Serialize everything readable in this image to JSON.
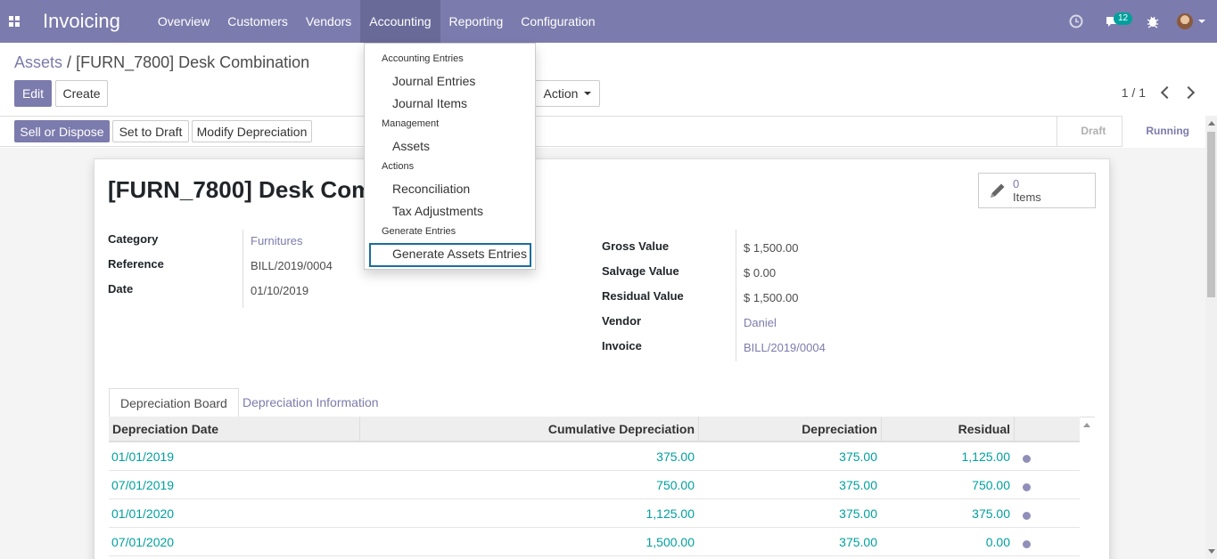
{
  "app": {
    "title": "Invoicing"
  },
  "navbar": {
    "menu": [
      "Overview",
      "Customers",
      "Vendors",
      "Accounting",
      "Reporting",
      "Configuration"
    ],
    "active_menu": "Accounting",
    "messages_count": "12",
    "icons": [
      "apps-icon",
      "clock-icon",
      "chat-icon",
      "bug-icon",
      "avatar"
    ]
  },
  "breadcrumb": {
    "parent": "Assets",
    "separator": "/",
    "current": "[FURN_7800] Desk Combination"
  },
  "control": {
    "edit_label": "Edit",
    "create_label": "Create",
    "action_label": "Action",
    "pager": "1 / 1"
  },
  "statusbar": {
    "buttons": [
      "Sell or Dispose",
      "Set to Draft",
      "Modify Depreciation"
    ],
    "stages": [
      "Draft",
      "Running"
    ],
    "current_stage": "Running"
  },
  "form": {
    "title": "[FURN_7800] Desk Com",
    "smart_button": {
      "count": "0",
      "label": "Items"
    },
    "left_fields": [
      {
        "label": "Category",
        "value": "Furnitures",
        "link": true
      },
      {
        "label": "Reference",
        "value": "BILL/2019/0004",
        "link": false
      },
      {
        "label": "Date",
        "value": "01/10/2019",
        "link": false
      }
    ],
    "right_fields": [
      {
        "label": "Gross Value",
        "value": "$ 1,500.00",
        "link": false
      },
      {
        "label": "Salvage Value",
        "value": "$ 0.00",
        "link": false
      },
      {
        "label": "Residual Value",
        "value": "$ 1,500.00",
        "link": false
      },
      {
        "label": "Vendor",
        "value": "Daniel",
        "link": true
      },
      {
        "label": "Invoice",
        "value": "BILL/2019/0004",
        "link": true
      }
    ]
  },
  "tabs": [
    "Depreciation Board",
    "Depreciation Information"
  ],
  "active_tab": "Depreciation Board",
  "table": {
    "columns": [
      "Depreciation Date",
      "Cumulative Depreciation",
      "Depreciation",
      "Residual"
    ],
    "rows": [
      [
        "01/01/2019",
        "375.00",
        "375.00",
        "1,125.00"
      ],
      [
        "07/01/2019",
        "750.00",
        "375.00",
        "750.00"
      ],
      [
        "01/01/2020",
        "1,125.00",
        "375.00",
        "375.00"
      ],
      [
        "07/01/2020",
        "1,500.00",
        "375.00",
        "0.00"
      ]
    ]
  },
  "accounting_menu": {
    "sections": [
      {
        "header": "Accounting Entries",
        "items": [
          "Journal Entries",
          "Journal Items"
        ]
      },
      {
        "header": "Management",
        "items": [
          "Assets"
        ]
      },
      {
        "header": "Actions",
        "items": [
          "Reconciliation",
          "Tax Adjustments"
        ]
      },
      {
        "header": "Generate Entries",
        "items": [
          "Generate Assets Entries"
        ]
      }
    ],
    "focused_item": "Generate Assets Entries"
  },
  "colors": {
    "brand": "#7c7bad",
    "link": "#00a09d",
    "focus": "#1b6e9c"
  }
}
